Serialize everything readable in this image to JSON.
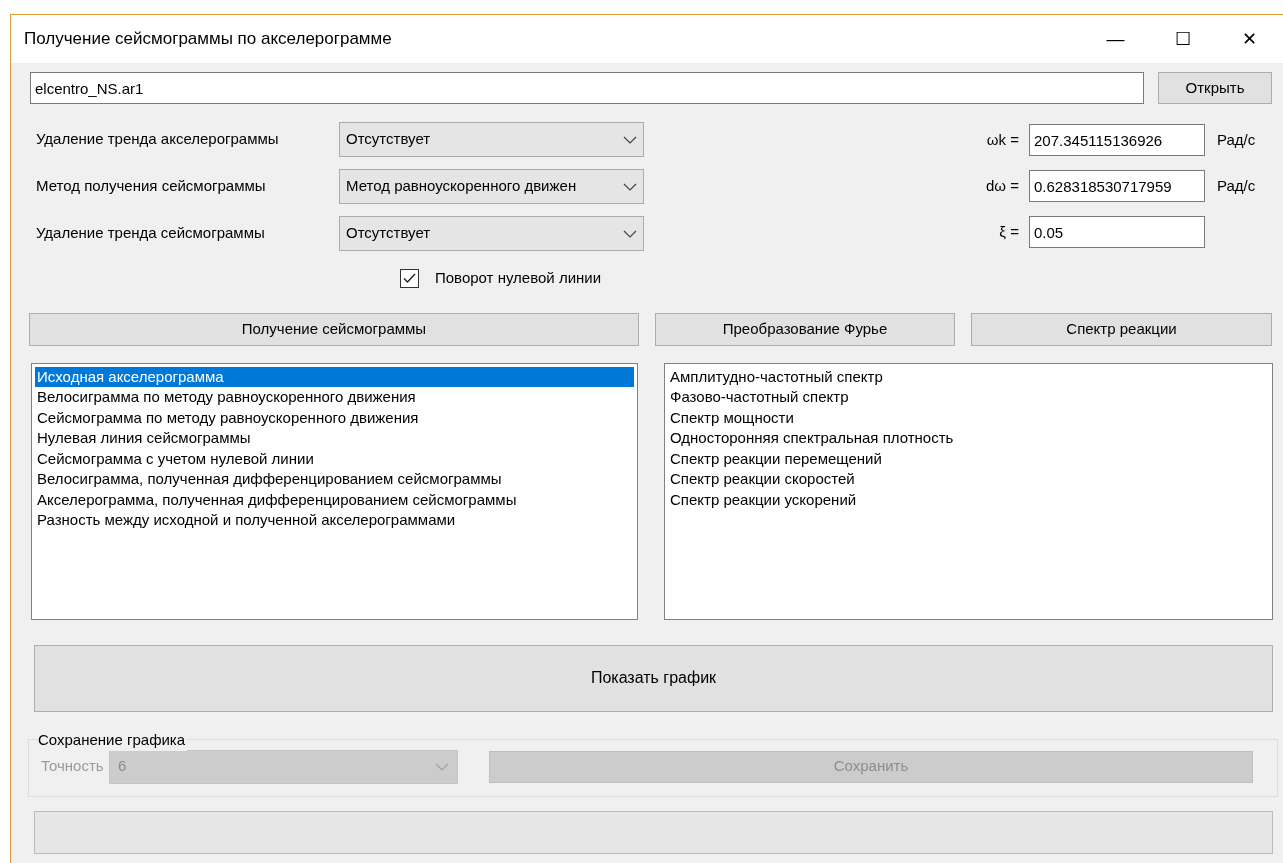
{
  "window": {
    "title": "Получение сейсмограммы по акселерограмме",
    "controls": [
      "—",
      "☐",
      "✕"
    ]
  },
  "file": {
    "value": "elcentro_NS.ar1",
    "button": "Открыть"
  },
  "options": [
    {
      "label": "Удаление тренда акселерограммы",
      "value": "Отсутствует"
    },
    {
      "label": "Метод получения сейсмограммы",
      "value": "Метод равноускоренного движен"
    },
    {
      "label": "Удаление тренда сейсмограммы",
      "value": "Отсутствует"
    }
  ],
  "parameters": [
    {
      "label": "ωk =",
      "value": "207.345115136926",
      "unit": "Рад/с"
    },
    {
      "label": "dω =",
      "value": "0.628318530717959",
      "unit": "Рад/с"
    },
    {
      "label": "ξ =",
      "value": "0.05"
    }
  ],
  "zero_line_rotation": {
    "label": "Поворот нулевой линии",
    "checked": true
  },
  "actions": [
    "Получение сейсмограммы",
    "Преобразование Фурье",
    "Спектр реакции"
  ],
  "seismogram_list": [
    {
      "text": "Исходная акселерограмма",
      "selected": true
    },
    {
      "text": "Велосиграмма по методу равноускоренного движения",
      "selected": false
    },
    {
      "text": "Сейсмограмма по методу равноускоренного движения",
      "selected": false
    },
    {
      "text": "Нулевая линия сейсмограммы",
      "selected": false
    },
    {
      "text": "Сейсмограмма с учетом нулевой линии",
      "selected": false
    },
    {
      "text": "Велосиграмма, полученная дифференцированием сейсмограммы",
      "selected": false
    },
    {
      "text": "Акселерограмма, полученная дифференцированием сейсмограммы",
      "selected": false
    },
    {
      "text": "Разность между исходной и полученной акселерограммами",
      "selected": false
    }
  ],
  "spectrum_list": [
    {
      "text": "Амплитудно-частотный спектр",
      "selected": false
    },
    {
      "text": "Фазово-частотный спектр",
      "selected": false
    },
    {
      "text": "Спектр мощности",
      "selected": false
    },
    {
      "text": "Односторонняя спектральная плотность",
      "selected": false
    },
    {
      "text": "Спектр реакции перемещений",
      "selected": false
    },
    {
      "text": "Спектр реакции скоростей",
      "selected": false
    },
    {
      "text": "Спектр реакции ускорений",
      "selected": false
    }
  ],
  "show_button": "Показать график",
  "save_group": {
    "title": "Сохранение графика",
    "precision_label": "Точность",
    "precision": "6",
    "button": "Сохранить",
    "disabled": true
  },
  "progress": {
    "level": 0
  }
}
